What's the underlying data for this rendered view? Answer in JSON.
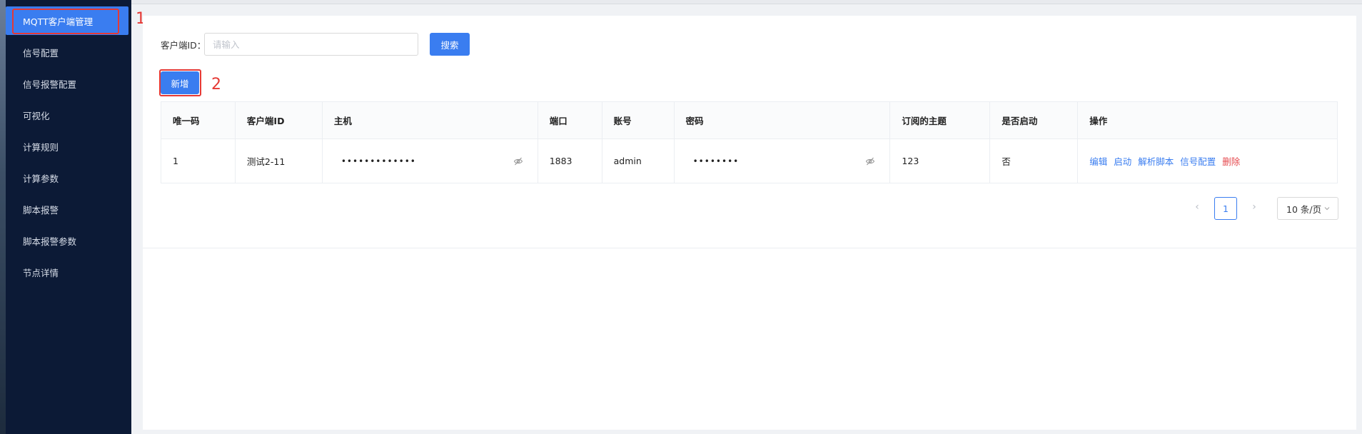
{
  "sidebar": {
    "items": [
      {
        "label": "MQTT客户端管理",
        "active": true
      },
      {
        "label": "信号配置"
      },
      {
        "label": "信号报警配置"
      },
      {
        "label": "可视化"
      },
      {
        "label": "计算规则"
      },
      {
        "label": "计算参数"
      },
      {
        "label": "脚本报警"
      },
      {
        "label": "脚本报警参数"
      },
      {
        "label": "节点详情"
      }
    ]
  },
  "annotations": {
    "one": "1",
    "two": "2"
  },
  "search": {
    "label": "客户端ID：",
    "placeholder": "请输入",
    "button": "搜索"
  },
  "toolbar": {
    "add_label": "新增"
  },
  "table": {
    "headers": [
      "唯一码",
      "客户端ID",
      "主机",
      "端口",
      "账号",
      "密码",
      "订阅的主题",
      "是否启动",
      "操作"
    ],
    "rows": [
      {
        "id": "1",
        "client_id": "测试2-11",
        "host": "•••••••••••••",
        "port": "1883",
        "account": "admin",
        "password": "••••••••",
        "topic": "123",
        "enabled": "否",
        "actions": [
          "编辑",
          "启动",
          "解析脚本",
          "信号配置",
          "删除"
        ]
      }
    ]
  },
  "pagination": {
    "prev": "‹",
    "next": "›",
    "current": "1",
    "page_size": "10 条/页"
  },
  "colors": {
    "primary": "#3a7df0",
    "danger": "#e5484d",
    "sidebar": "#0c1a36",
    "annotation": "#e53935"
  }
}
